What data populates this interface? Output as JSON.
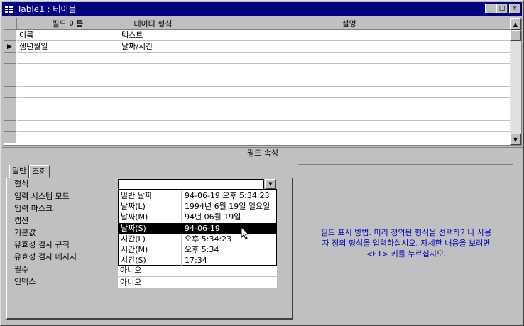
{
  "window": {
    "title": "Table1 : 테이블",
    "minimize_glyph": "_",
    "maximize_glyph": "□",
    "close_glyph": "×"
  },
  "grid": {
    "columns": [
      "필드 이름",
      "데이터 형식",
      "설명"
    ],
    "rows": [
      {
        "name": "이름",
        "type": "텍스트",
        "desc": ""
      },
      {
        "name": "생년월일",
        "type": "날짜/시간",
        "desc": ""
      }
    ],
    "current_row_indicator": "▶",
    "current_row": 1
  },
  "properties_header": "필드 속성",
  "tabs": [
    {
      "label": "일반",
      "active": true
    },
    {
      "label": "조회",
      "active": false
    }
  ],
  "properties": [
    {
      "label": "형식",
      "value": ""
    },
    {
      "label": "입력 시스템 모드",
      "value": ""
    },
    {
      "label": "입력 마스크",
      "value": ""
    },
    {
      "label": "캡션",
      "value": ""
    },
    {
      "label": "기본값",
      "value": ""
    },
    {
      "label": "유효성 검사 규칙",
      "value": ""
    },
    {
      "label": "유효성 검사 메시지",
      "value": ""
    },
    {
      "label": "필수",
      "value": "아니오"
    },
    {
      "label": "인덱스",
      "value": "아니오"
    }
  ],
  "format_dropdown": {
    "options": [
      {
        "name": "일반 날짜",
        "example": "94-06-19 오후 5:34:23"
      },
      {
        "name": "날짜(L)",
        "example": "1994년 6월 19일 일요일"
      },
      {
        "name": "날짜(M)",
        "example": "94년 06월 19일"
      },
      {
        "name": "날짜(S)",
        "example": "94-06-19"
      },
      {
        "name": "시간(L)",
        "example": "오후 5:34:23"
      },
      {
        "name": "시간(M)",
        "example": "오후 5:34"
      },
      {
        "name": "시간(S)",
        "example": "17:34"
      }
    ],
    "selected_index": 3
  },
  "help_text": {
    "line1": "필드 표시 방법. 미리 정의된 형식을 선택하거나 사용",
    "line2": "자 정의 형식을 입력하십시오. 자세한 내용을 보려면",
    "line3": "<F1> 키를 누르십시오."
  },
  "colors": {
    "titlebar": "#000080",
    "face": "#c0c0c0",
    "help_text": "#0000c0",
    "selection": "#000000"
  }
}
